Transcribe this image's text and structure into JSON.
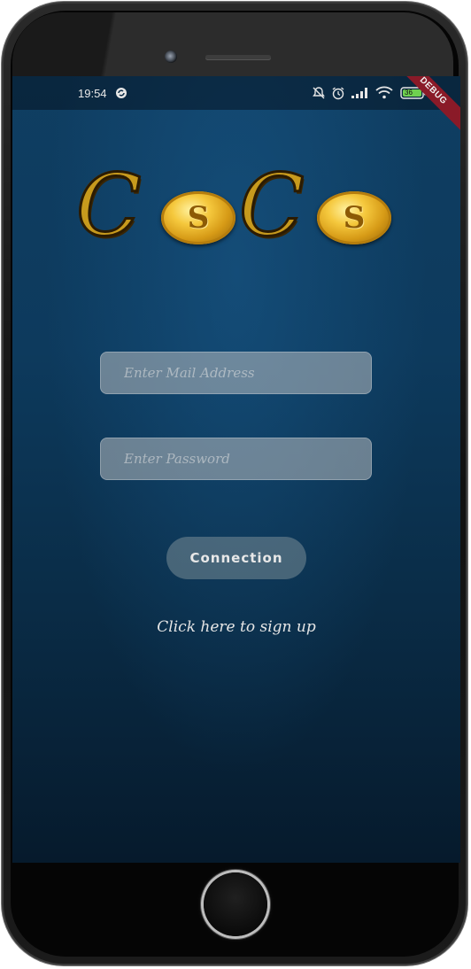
{
  "statusbar": {
    "time": "19:54",
    "battery": "36",
    "debug_banner": "DEBUG"
  },
  "logo": {
    "text": "CoCo",
    "letters": [
      "C",
      "S",
      "C",
      "S"
    ]
  },
  "form": {
    "email_placeholder": "Enter Mail Address",
    "password_placeholder": "Enter Password",
    "connect_label": "Connection",
    "signup_link": "Click here to sign up"
  },
  "colors": {
    "background": "#0f3e62",
    "field_bg": "#c8c8c8",
    "button_bg": "#788c96",
    "debug_banner": "#8a1a28",
    "logo_gold": "#c79a1d"
  },
  "icons": [
    "sync-icon",
    "notifications-off-icon",
    "alarm-icon",
    "signal-icon",
    "wifi-icon",
    "battery-icon"
  ]
}
